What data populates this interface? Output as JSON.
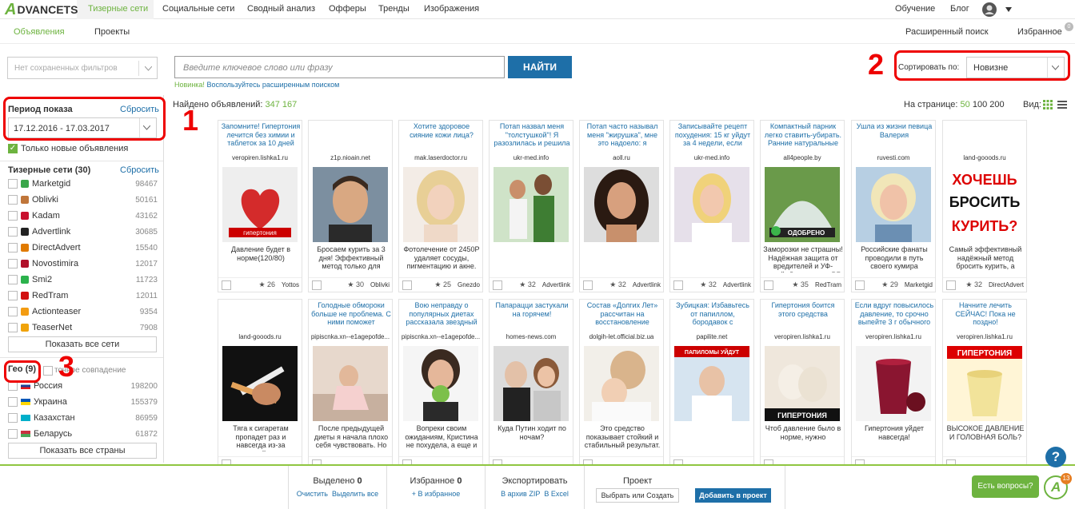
{
  "brand": {
    "logo_letter": "A",
    "logo_text": "DVANCETS"
  },
  "nav": {
    "items": [
      "Тизерные сети",
      "Социальные сети",
      "Сводный анализ",
      "Офферы",
      "Тренды",
      "Изображения"
    ],
    "right": [
      "Обучение",
      "Блог"
    ]
  },
  "subnav": {
    "ads": "Объявления",
    "projects": "Проекты",
    "advanced": "Расширенный поиск",
    "favorites": "Избранное",
    "fav_count": "0"
  },
  "filters": {
    "saved_placeholder": "Нет сохраненных фильтров"
  },
  "search": {
    "placeholder": "Введите ключевое слово или фразу",
    "button": "НАЙТИ",
    "hint_new": "Новинка!",
    "hint_text": "Воспользуйтесь расширенным поиском"
  },
  "sort": {
    "label": "Сортировать по:",
    "value": "Новизне"
  },
  "period": {
    "title": "Период показа",
    "reset": "Сбросить",
    "value": "17.12.2016 - 17.03.2017",
    "only_new": "Только новые объявления"
  },
  "networks": {
    "title": "Тизерные сети (30)",
    "reset": "Сбросить",
    "show_all": "Показать все сети",
    "items": [
      {
        "name": "Marketgid",
        "count": "98467",
        "color": "#3aa64a"
      },
      {
        "name": "Oblivki",
        "count": "50161",
        "color": "#c0763a"
      },
      {
        "name": "Kadam",
        "count": "43162",
        "color": "#c8102e"
      },
      {
        "name": "Advertlink",
        "count": "30685",
        "color": "#222222"
      },
      {
        "name": "DirectAdvert",
        "count": "15540",
        "color": "#e07a00"
      },
      {
        "name": "Novostimira",
        "count": "12017",
        "color": "#b0102a"
      },
      {
        "name": "Smi2",
        "count": "11723",
        "color": "#2bb24c"
      },
      {
        "name": "RedTram",
        "count": "12011",
        "color": "#d11010"
      },
      {
        "name": "Actionteaser",
        "count": "9354",
        "color": "#f39c12"
      },
      {
        "name": "TeaserNet",
        "count": "7908",
        "color": "#f0a30a"
      }
    ]
  },
  "geo": {
    "title": "Гео (9)",
    "exact": "точное совпадение",
    "show_all": "Показать все страны",
    "items": [
      {
        "name": "Россия",
        "count": "198200"
      },
      {
        "name": "Украина",
        "count": "155379"
      },
      {
        "name": "Казахстан",
        "count": "86959"
      },
      {
        "name": "Беларусь",
        "count": "61872"
      }
    ]
  },
  "results": {
    "found_label": "Найдено объявлений:",
    "found_count": "347 167",
    "per_page_label": "На странице:",
    "per_page": [
      "50",
      "100",
      "200"
    ],
    "view_label": "Вид:"
  },
  "cards_row1": [
    {
      "title": "Запомните! Гипертония лечится без химии и таблеток за 10 дней",
      "domain": "veropiren.lishka1.ru",
      "desc": "Давление будет в норме(120/80)",
      "stars": "★ 26",
      "net": "Yottos",
      "img": "heart"
    },
    {
      "title": "",
      "domain": "z1p.nioain.net",
      "desc": "Бросаем курить за 3 дня! Эффективный метод только для мужчин",
      "stars": "★ 30",
      "net": "Oblivki",
      "img": "man"
    },
    {
      "title": "Хотите здоровое сияние кожи лица?",
      "domain": "mak.laserdoctor.ru",
      "desc": "Фотолечение от 2450Р удаляет сосуды, пигментацию и акне.",
      "stars": "★ 25",
      "net": "Gnezdo",
      "img": "blonde"
    },
    {
      "title": "Потап назвал меня \"толстушкой\"! Я разозлилась и решила",
      "domain": "ukr-med.info",
      "desc": "",
      "stars": "★ 32",
      "net": "Advertlink",
      "img": "couple"
    },
    {
      "title": "Потап часто называл меня \"жирушка\", мне это надоело: я",
      "domain": "aoll.ru",
      "desc": "",
      "stars": "★ 32",
      "net": "Advertlink",
      "img": "brunette"
    },
    {
      "title": "Записывайте рецепт похудения: 15 кг уйдут за 4 недели, если",
      "domain": "ukr-med.info",
      "desc": "",
      "stars": "★ 32",
      "net": "Advertlink",
      "img": "singer"
    },
    {
      "title": "Компактный парник легко ставить-убирать. Ранние натуральные",
      "domain": "all4people.by",
      "desc": "Заморозки не страшны! Надёжная защита от вредителей и УФ-лучей. Доставка по РБ",
      "stars": "★ 35",
      "net": "RedTram",
      "img": "greenhouse"
    },
    {
      "title": "Ушла из жизни певица Валерия",
      "domain": "ruvesti.com",
      "desc": "Российские фанаты проводили в путь своего кумира",
      "stars": "★ 29",
      "net": "Marketgid",
      "img": "valeria"
    },
    {
      "title": "",
      "domain": "land-gooods.ru",
      "desc": "Самый эффективный надёжный метод бросить курить, а главное моментально",
      "stars": "★ 32",
      "net": "DirectAdvert",
      "img": "smoke"
    }
  ],
  "cards_row2": [
    {
      "title": "",
      "domain": "land-gooods.ru",
      "desc": "Тяга к сигаретам пропадет раз и навсегда из-за простейшего",
      "img": "cig"
    },
    {
      "title": "Голодные обмороки больше не проблема. С ними поможет",
      "domain": "pipiscnka.xn--e1agepofde...",
      "desc": "После предыдущей диеты я начала плохо себя чувствовать. Но",
      "img": "sofa"
    },
    {
      "title": "Вою неправду о популярных диетах рассказала звездный",
      "domain": "pipiscnka.xn--e1agepofde...",
      "desc": "Вопреки своим ожиданиям, Кристина не похудела, а еще и",
      "img": "apple"
    },
    {
      "title": "Папарацци застукали на горячем!",
      "domain": "homes-news.com",
      "desc": "Куда Путин ходит по ночам?",
      "img": "putin"
    },
    {
      "title": "Состав «Долгих Лет» рассчитан на восстановление",
      "domain": "dolgih-let.official.biz.ua",
      "desc": "Это средство показывает стойкий и стабильный результат.",
      "img": "baby"
    },
    {
      "title": "Зубицкая: Избавьтесь от папиллом, бородавок с",
      "domain": "papilite.net",
      "desc": "",
      "img": "doctor"
    },
    {
      "title": "Гипертония боится этого средства",
      "domain": "veropiren.lishka1.ru",
      "desc": "Чтоб давление было в норме, нужно",
      "img": "garlic"
    },
    {
      "title": "Если вдруг повысилось давление, то срочно выпейте 3 г обычного",
      "domain": "veropiren.lishka1.ru",
      "desc": "Гипертония уйдет навсегда!",
      "img": "juice"
    },
    {
      "title": "Начните лечить СЕЙЧАС! Пока не поздно!",
      "domain": "veropiren.lishka1.ru",
      "desc": "ВЫСОКОЕ ДАВЛЕНИЕ И ГОЛОВНАЯ БОЛЬ?",
      "img": "pressure"
    }
  ],
  "img_labels": {
    "hypertension": "гипертония",
    "approved": "ОДОБРЕНО",
    "want": "ХОЧЕШЬ",
    "quit": "БРОСИТЬ",
    "smoke": "КУРИТЬ?",
    "papill": "ПАПИЛОМЫ УЙДУТ",
    "hyper_caps": "ГИПЕРТОНИЯ"
  },
  "bottom": {
    "selected_label": "Выделено",
    "selected_count": "0",
    "clear": "Очистить",
    "select_all": "Выделить все",
    "fav_label": "Избранное",
    "fav_count": "0",
    "to_fav": "+ В избранное",
    "export_label": "Экспортировать",
    "zip": "В архив ZIP",
    "excel": "В Excel",
    "project_label": "Проект",
    "project_select": "Выбрать или Создать",
    "add_project": "Добавить в проект"
  },
  "help": {
    "question": "?",
    "chat": "Есть вопросы?",
    "badge": "13"
  },
  "annotations": [
    "1",
    "2",
    "3"
  ]
}
